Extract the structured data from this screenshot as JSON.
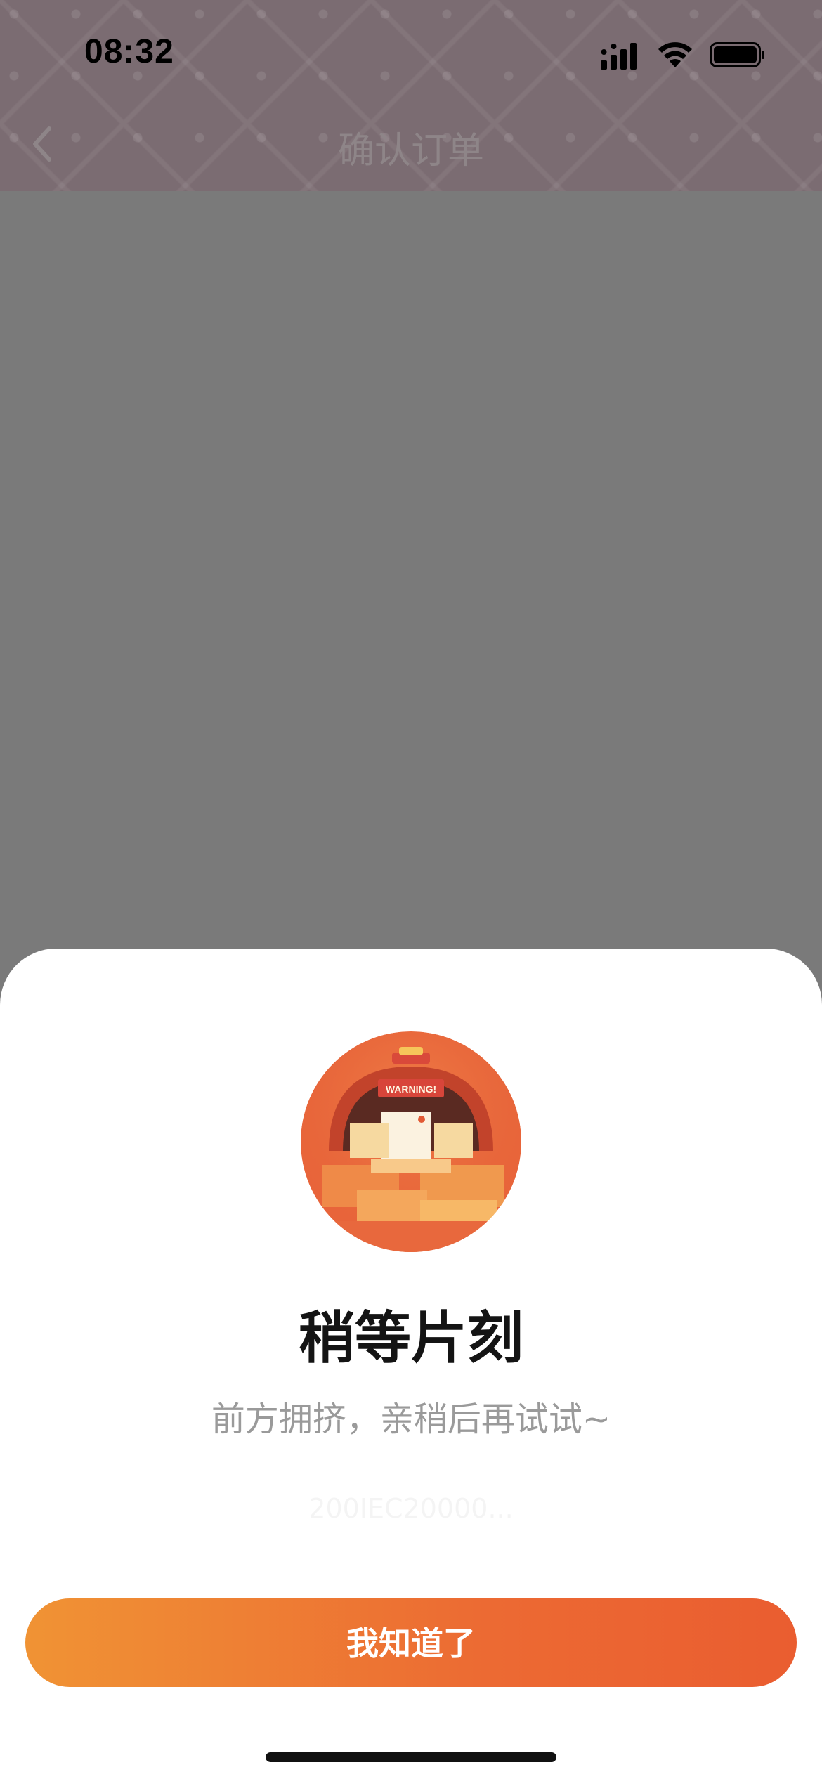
{
  "status_bar": {
    "time": "08:32"
  },
  "nav": {
    "title": "确认订单",
    "back_icon": "chevron-left-icon"
  },
  "dialog": {
    "illustration_text": "WARNING!",
    "title": "稍等片刻",
    "message": "前方拥挤，亲稍后再试试~",
    "code": "200IEC20000...",
    "button_label": "我知道了"
  },
  "colors": {
    "button_gradient_start": "#f09334",
    "button_gradient_end": "#ea5d30",
    "overlay": "#7a7a7a",
    "header": "#7b6c72"
  }
}
